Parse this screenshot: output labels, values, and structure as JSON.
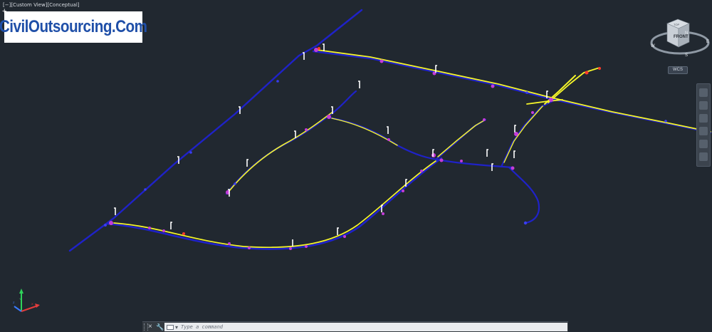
{
  "viewport": {
    "label": "[−][Custom View][Conceptual]",
    "plus": "+"
  },
  "logo": {
    "text": "CivilOutsourcing.Com"
  },
  "viewcube": {
    "face_label": "FRONT",
    "top_label": "TOP",
    "compass": {
      "n": "N",
      "e": "E",
      "s": "S",
      "w": "W"
    },
    "coordinate_system": "WCS"
  },
  "ucs_icon": {
    "x": "X",
    "y": "Y",
    "z": "Z"
  },
  "command_line": {
    "close": "×",
    "customize": "🔧",
    "placeholder": "Type a command"
  },
  "colors": {
    "background": "#212830",
    "pipe": "#1f22c8",
    "highlight": "#f5f52a",
    "node": "#c43cd8",
    "tick": "#ffffff",
    "accent_red": "#ff3b2a"
  }
}
